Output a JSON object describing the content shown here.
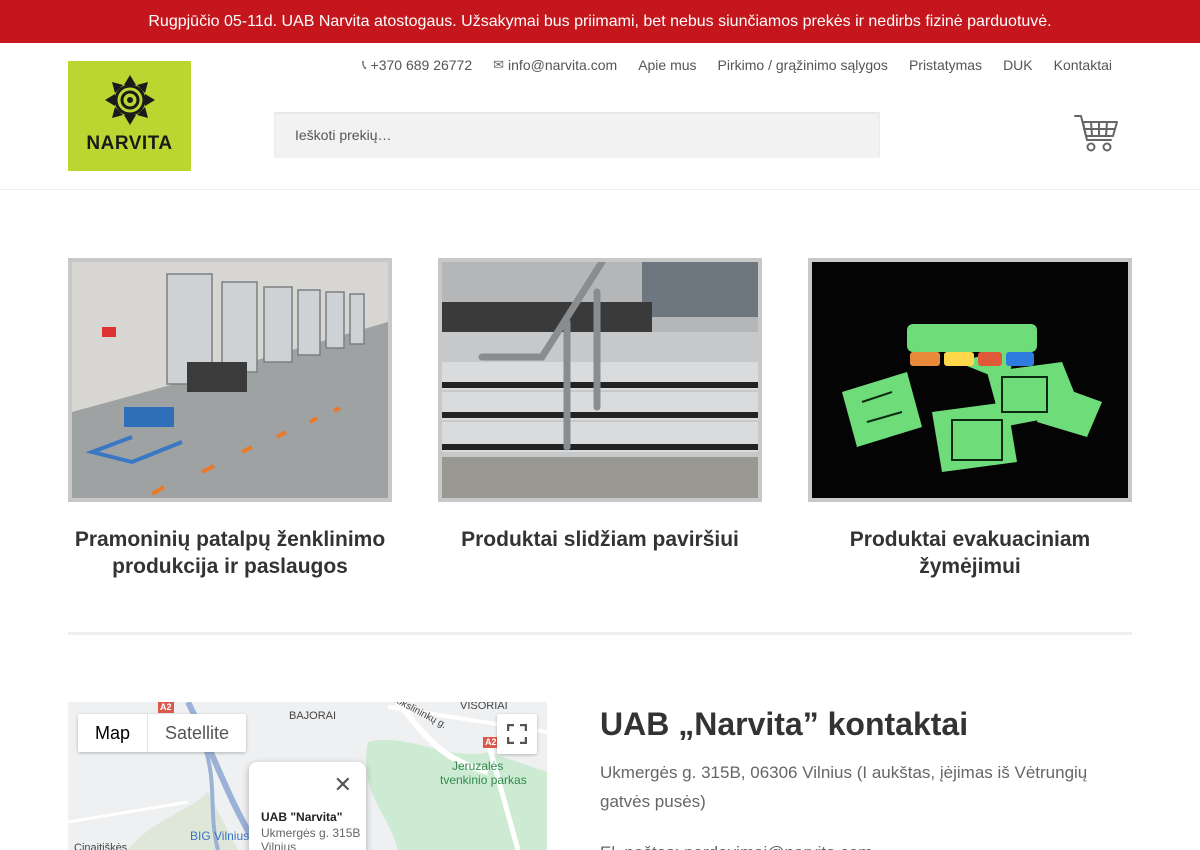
{
  "notice": {
    "text": "Rugpjūčio 05-11d. UAB Narvita atostogaus. Užsakymai bus priimami, bet nebus siunčiamos prekės ir nedirbs fizinė parduotuvė.",
    "background": "#c4161c"
  },
  "header": {
    "logo_text": "NARVITA",
    "logo_color": "#bcd631",
    "nav": {
      "phone": "+370 689 26772",
      "email": "info@narvita.com",
      "links": [
        "Apie mus",
        "Pirkimo / grąžinimo sąlygos",
        "Pristatymas",
        "DUK",
        "Kontaktai"
      ]
    },
    "search_placeholder": "Ieškoti prekių…",
    "cart_icon": "shopping-cart-icon"
  },
  "categories": [
    {
      "title": "Pramoninių patalpų ženklinimo produkcija ir paslaugos"
    },
    {
      "title": "Produktai slidžiam paviršiui"
    },
    {
      "title": "Produktai evakuaciniam žymėjimui"
    }
  ],
  "map": {
    "tabs": [
      "Map",
      "Satellite"
    ],
    "active_tab": "Map",
    "infobox_name": "UAB \"Narvita\"",
    "infobox_address": "Ukmergės g. 315B",
    "infobox_city": "Vilnius",
    "labels": {
      "bajorai": "BAJORAI",
      "visoriai": "VISORIAI",
      "park": "Jeruzalės",
      "park2": "tvenkinio parkas",
      "big": "BIG Vilnius",
      "street": "Mokslininkų g.",
      "cinciskes": "Cinaitiškės",
      "route1": "A2",
      "route2": "A2"
    }
  },
  "contacts": {
    "title": "UAB „Narvita” kontaktai",
    "address": "Ukmergės g. 315B, 06306 Vilnius (I aukštas, įėjimas iš Vėtrungių gatvės pusės)",
    "email_line": "El. paštas: pardavimai@narvita.com"
  }
}
